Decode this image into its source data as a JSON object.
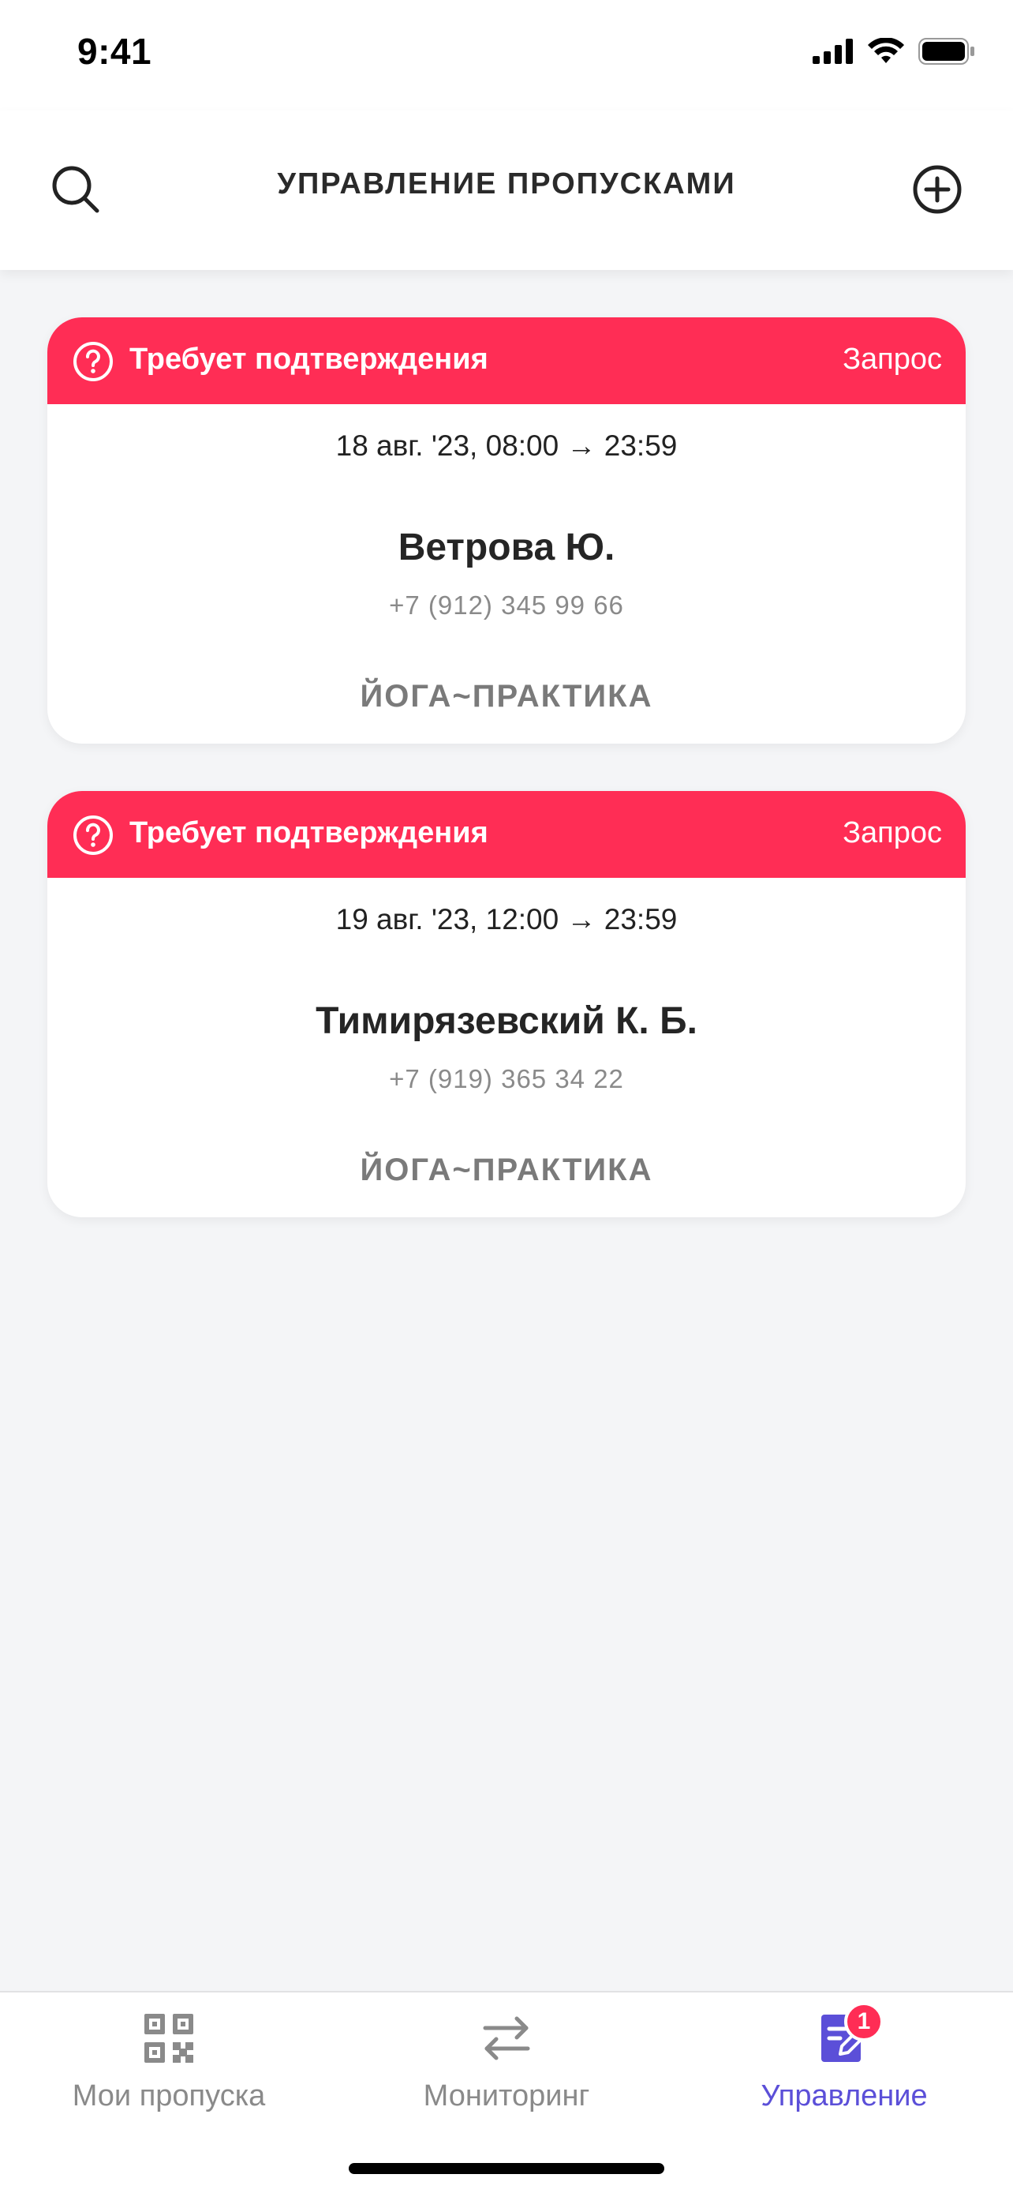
{
  "status_bar": {
    "time": "9:41"
  },
  "header": {
    "title": "УПРАВЛЕНИЕ ПРОПУСКАМИ"
  },
  "passes": [
    {
      "status": "Требует подтверждения",
      "type": "Запрос",
      "date": "18 авг. '23, 08:00 → 23:59",
      "name": "Ветрова Ю.",
      "phone": "+7 (912) 345 99 66",
      "zone": "ЙОГА~ПРАКТИКА"
    },
    {
      "status": "Требует подтверждения",
      "type": "Запрос",
      "date": "19 авг. '23, 12:00 → 23:59",
      "name": "Тимирязевский К. Б.",
      "phone": "+7 (919) 365 34 22",
      "zone": "ЙОГА~ПРАКТИКА"
    }
  ],
  "tabbar": {
    "tabs": [
      {
        "label": "Мои пропуска",
        "icon": "qr-code-icon",
        "active": false
      },
      {
        "label": "Мониторинг",
        "icon": "transfer-arrows-icon",
        "active": false
      },
      {
        "label": "Управление",
        "icon": "edit-document-icon",
        "active": true,
        "badge": "1"
      }
    ]
  },
  "colors": {
    "accent": "#5b4fd8",
    "alert": "#ff2d55",
    "background": "#f4f5f7"
  }
}
